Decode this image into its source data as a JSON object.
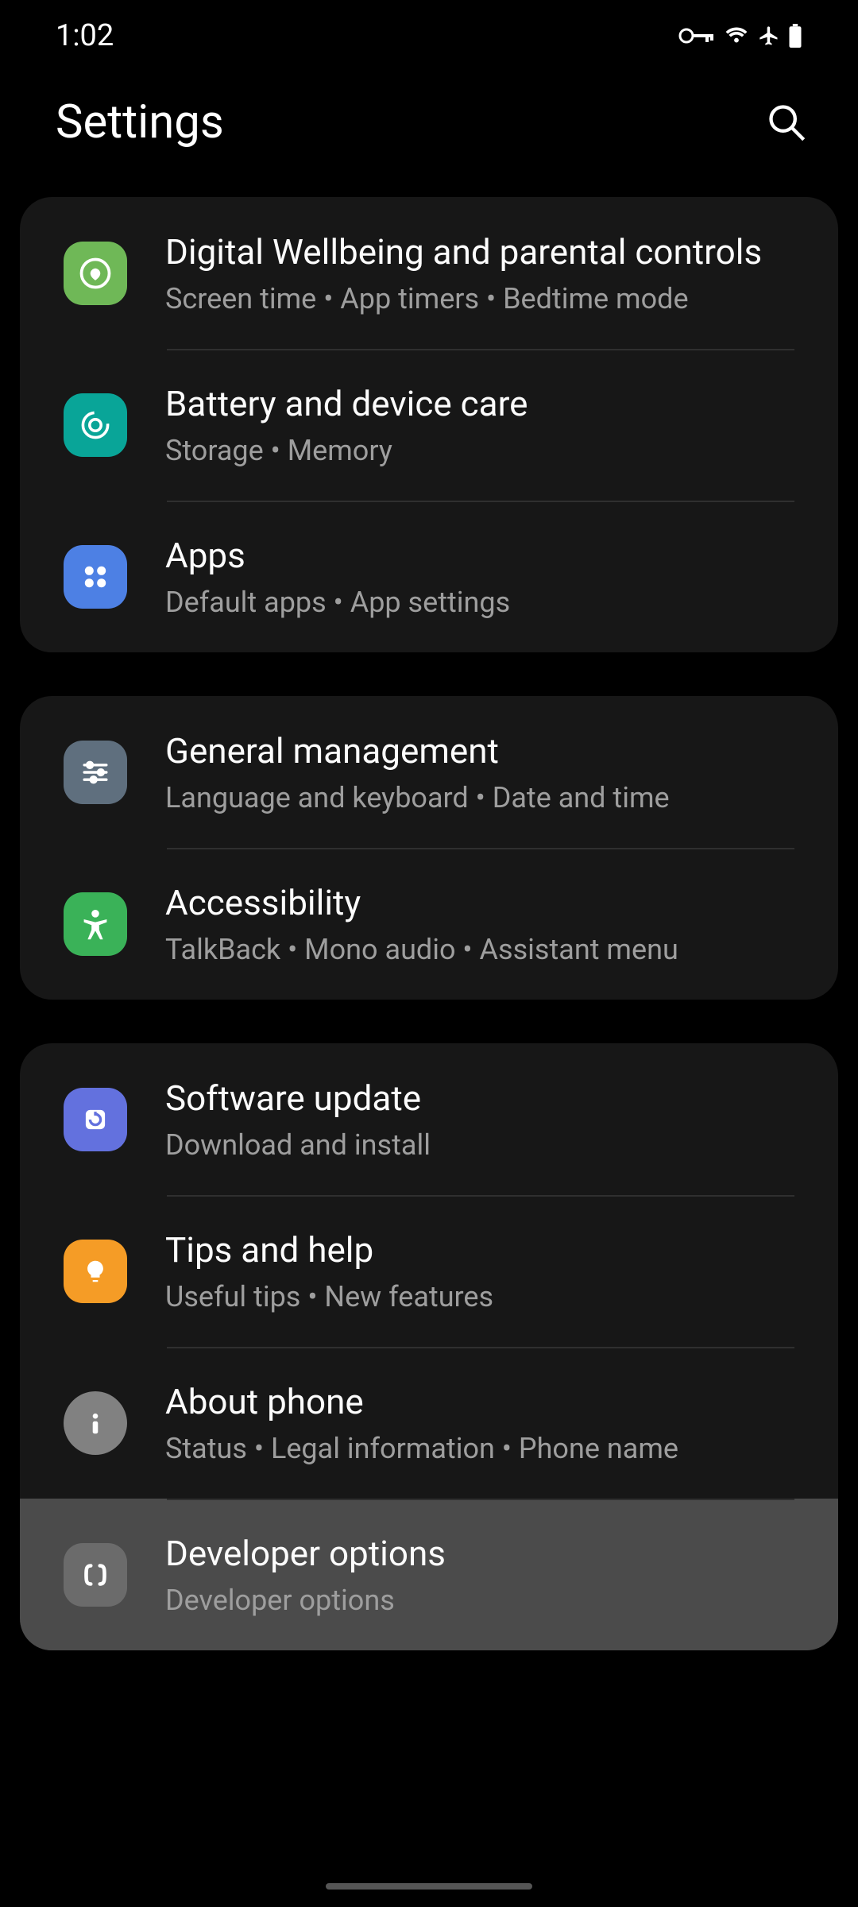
{
  "status": {
    "time": "1:02"
  },
  "header": {
    "title": "Settings"
  },
  "groups": [
    {
      "items": [
        {
          "icon": "wellbeing",
          "title": "Digital Wellbeing and parental controls",
          "sub": "Screen time  •  App timers  •  Bedtime mode"
        },
        {
          "icon": "battery",
          "title": "Battery and device care",
          "sub": "Storage  •  Memory"
        },
        {
          "icon": "apps",
          "title": "Apps",
          "sub": "Default apps  •  App settings"
        }
      ]
    },
    {
      "items": [
        {
          "icon": "general",
          "title": "General management",
          "sub": "Language and keyboard  •  Date and time"
        },
        {
          "icon": "access",
          "title": "Accessibility",
          "sub": "TalkBack  •  Mono audio  •  Assistant menu"
        }
      ]
    },
    {
      "items": [
        {
          "icon": "update",
          "title": "Software update",
          "sub": "Download and install"
        },
        {
          "icon": "tips",
          "title": "Tips and help",
          "sub": "Useful tips  •  New features"
        },
        {
          "icon": "about",
          "title": "About phone",
          "sub": "Status  •  Legal information  •  Phone name"
        },
        {
          "icon": "dev",
          "title": "Developer options",
          "sub": "Developer options",
          "highlighted": true
        }
      ]
    }
  ]
}
